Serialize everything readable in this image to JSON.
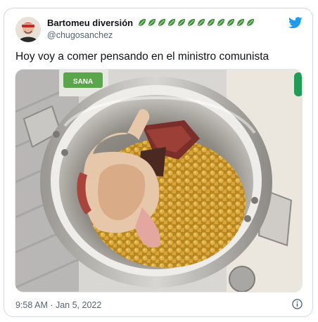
{
  "tweet": {
    "author_name": "Bartomeu diversión",
    "author_handle": "@chugosanchez",
    "name_emojis": [
      "leaf-emoji",
      "leaf-emoji",
      "leaf-emoji",
      "leaf-emoji",
      "leaf-emoji",
      "leaf-emoji",
      "leaf-emoji",
      "leaf-emoji",
      "leaf-emoji",
      "leaf-emoji",
      "leaf-emoji",
      "leaf-emoji"
    ],
    "text": "Hoy voy a comer pensando en el ministro comunista",
    "timestamp": "9:58 AM · Jan 5, 2022",
    "photo_label_text": "SANA"
  },
  "colors": {
    "twitter_blue": "#1d9bf0",
    "secondary_text": "#536471",
    "leaf_green": "#3f8f3a"
  },
  "icons": {
    "brand": "twitter-bird-icon",
    "info": "info-icon"
  }
}
